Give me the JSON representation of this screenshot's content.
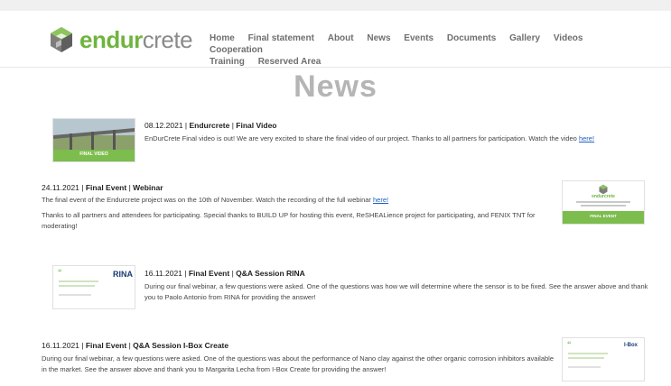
{
  "logo": {
    "part1": "endur",
    "part2": "crete"
  },
  "nav": {
    "items": [
      "Home",
      "Final statement",
      "About",
      "News",
      "Events",
      "Documents",
      "Gallery",
      "Videos",
      "Cooperation",
      "Training",
      "Reserved Area"
    ]
  },
  "page_title": "News",
  "posts": [
    {
      "date": "08.12.2021",
      "category": "Endurcrete",
      "title": "Final Video",
      "text": "EnDurCrete Final video is out! We are very excited to share the final video of our project. Thanks to all partners for participation. Watch the video ",
      "link": "here!",
      "thumb_label": "FINAL VIDEO"
    },
    {
      "date": "24.11.2021",
      "category": "Final Event",
      "title": "Webinar",
      "text": "The final event of the Endurcrete project was on the 10th of November. Watch the recording of the full webinar ",
      "link": "here!",
      "text2": "Thanks to all partners and attendees for participating. Special thanks to BUILD UP for hosting this event, ReSHEALience project for participating, and FENIX TNT for moderating!",
      "thumb_brand": "endurcrete",
      "thumb_label": "FINAL EVENT"
    },
    {
      "date": "16.11.2021",
      "category": "Final Event",
      "title": "Q&A Session RINA",
      "text": "During our final webinar, a few questions were asked. One of the questions was how we will determine where the sensor is to be fixed. See the answer above and thank you to Paolo Antonio from RINA for providing the answer!",
      "thumb_brand": "RINA"
    },
    {
      "date": "16.11.2021",
      "category": "Final Event",
      "title": "Q&A Session I-Box Create",
      "text": "During our final webinar, a few questions were asked. One of the questions was about the performance of Nano clay against the other organic corrosion inhibitors available in the market. See the answer above and thank you to Margarita Lecha from I-Box Create for providing the answer!",
      "thumb_brand": "I-Box"
    }
  ]
}
